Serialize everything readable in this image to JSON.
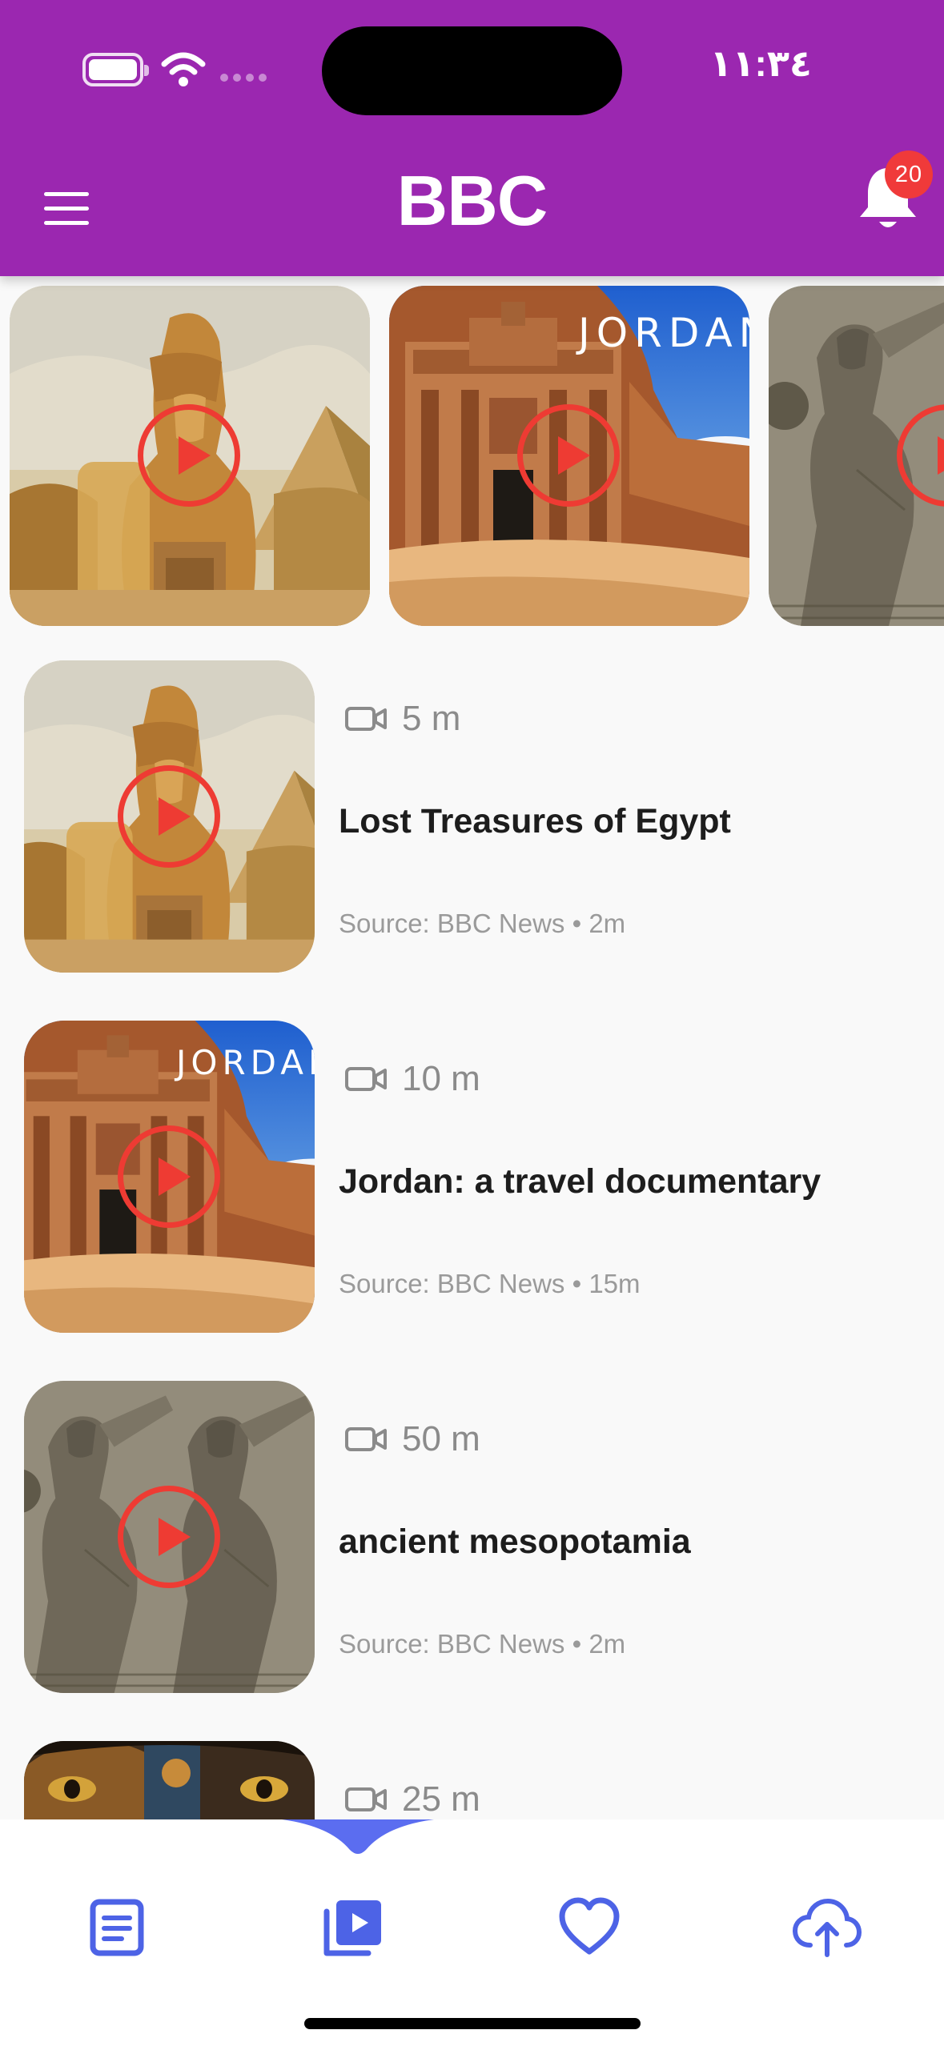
{
  "status_bar": {
    "time": "١١:٣٤"
  },
  "header": {
    "logo": "BBC",
    "notification_count": "20"
  },
  "carousel": [
    {
      "thumbnail": "egypt-sphinx"
    },
    {
      "thumbnail": "jordan-petra",
      "overlay_text": "JORDAN"
    },
    {
      "thumbnail": "mesopotamia-relief"
    }
  ],
  "videos": [
    {
      "duration": "5 m",
      "title": "Lost Treasures of Egypt",
      "source": "Source: BBC News • 2m",
      "thumbnail": "egypt-sphinx"
    },
    {
      "duration": "10 m",
      "title": "Jordan: a travel documentary",
      "source": "Source: BBC News • 15m",
      "thumbnail": "jordan-petra",
      "overlay_text": "JORDAN"
    },
    {
      "duration": "50 m",
      "title": "ancient mesopotamia",
      "source": "Source: BBC News • 2m",
      "thumbnail": "mesopotamia-relief"
    },
    {
      "duration": "25 m",
      "title": "",
      "source": "",
      "thumbnail": "lion-eyes"
    }
  ],
  "bottom_nav": {
    "items": [
      {
        "icon": "news-article-icon",
        "active": false
      },
      {
        "icon": "video-library-icon",
        "active": true
      },
      {
        "icon": "heart-icon",
        "active": false
      },
      {
        "icon": "cloud-upload-icon",
        "active": false
      }
    ]
  },
  "colors": {
    "header": "#9b27b0",
    "play": "#ee3b33",
    "badge": "#f03a3a",
    "nav_icon": "#4d63e6",
    "background": "#f9f9f9"
  }
}
